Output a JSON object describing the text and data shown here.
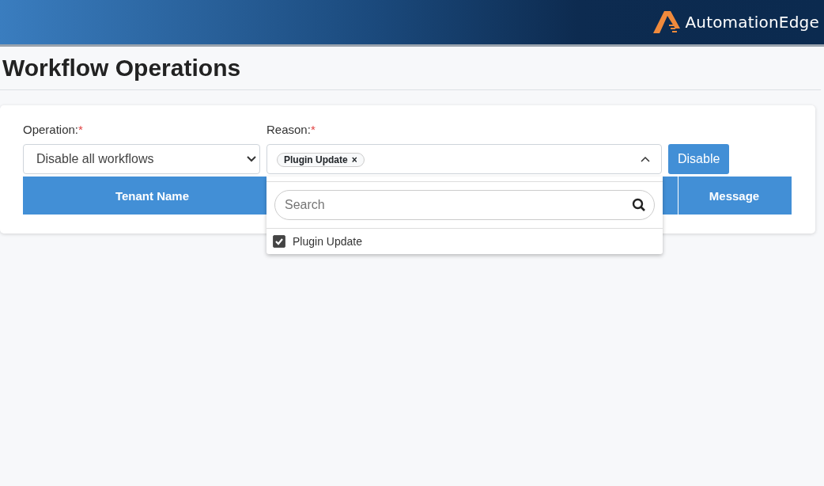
{
  "header": {
    "brand": "AutomationEdge"
  },
  "page_title": "Workflow Operations",
  "form": {
    "operation": {
      "label": "Operation:",
      "required_mark": "*",
      "value": "Disable all workflows"
    },
    "reason": {
      "label": "Reason:",
      "required_mark": "*",
      "tags": [
        {
          "label": "Plugin Update",
          "remove": "×"
        }
      ],
      "expanded": true,
      "dropdown": {
        "search_placeholder": "Search",
        "options": [
          {
            "label": "Plugin Update",
            "checked": true
          }
        ]
      }
    },
    "button": "Disable"
  },
  "table": {
    "columns": [
      "Tenant Name",
      "Message"
    ]
  }
}
